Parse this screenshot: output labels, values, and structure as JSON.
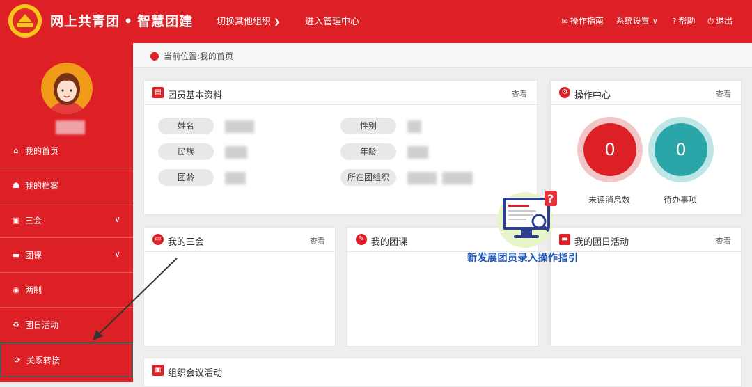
{
  "header": {
    "brand_main": "网上共青团",
    "brand_dot": "•",
    "brand_sub": "智慧团建",
    "nav_switch": "切换其他组织",
    "nav_admin": "进入管理中心",
    "links": {
      "ops": "操作指南",
      "settings": "系统设置",
      "help": "帮助",
      "logout": "退出"
    }
  },
  "sidebar": {
    "items": [
      {
        "label": "我的首页",
        "icon": "home-icon"
      },
      {
        "label": "我的档案",
        "icon": "profile-icon"
      },
      {
        "label": "三会",
        "icon": "meeting-icon",
        "expandable": true
      },
      {
        "label": "团课",
        "icon": "folder-icon",
        "expandable": true
      },
      {
        "label": "两制",
        "icon": "target-icon"
      },
      {
        "label": "团日活动",
        "icon": "recycle-icon"
      },
      {
        "label": "关系转接",
        "icon": "transfer-icon",
        "active": true
      }
    ]
  },
  "breadcrumb": "当前位置:我的首页",
  "profile_panel": {
    "title": "团员基本资料",
    "more": "查看",
    "fields": [
      "姓名",
      "民族",
      "团龄",
      "性别",
      "年龄",
      "所在团组织"
    ]
  },
  "ops_panel": {
    "title": "操作中心",
    "more": "查看",
    "unread_count": "0",
    "unread_label": "未读消息数",
    "todo_count": "0",
    "todo_label": "待办事项"
  },
  "panels": {
    "meetings": {
      "title": "我的三会",
      "more": "查看"
    },
    "course": {
      "title": "我的团课"
    },
    "activity": {
      "title": "我的团日活动",
      "more": "查看"
    },
    "org_meeting": {
      "title": "组织会议活动"
    }
  },
  "guide_overlay": "新发展团员录入操作指引",
  "colors": {
    "brand_red": "#dd1f26",
    "teal": "#2aa6a8",
    "guide_blue": "#1d56b6"
  }
}
